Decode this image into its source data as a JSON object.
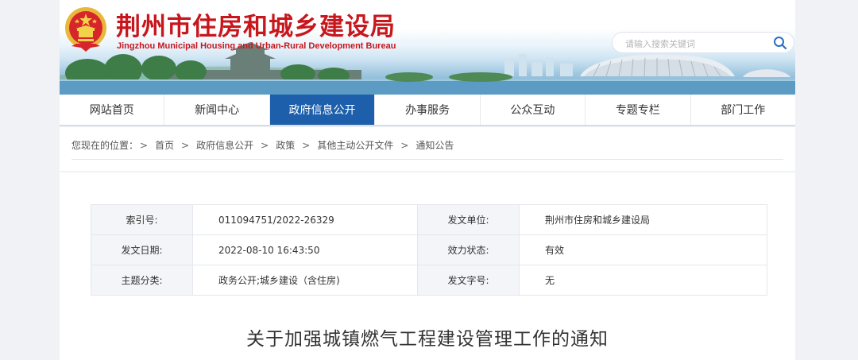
{
  "header": {
    "title": "荆州市住房和城乡建设局",
    "subtitle": "Jingzhou Municipal Housing and Urban-Rural Development Bureau",
    "search_placeholder": "请输入搜索关键词"
  },
  "nav": {
    "items": [
      "网站首页",
      "新闻中心",
      "政府信息公开",
      "办事服务",
      "公众互动",
      "专题专栏",
      "部门工作"
    ],
    "active_index": 2
  },
  "breadcrumb": {
    "prefix": "您现在的位置：",
    "items": [
      "首页",
      "政府信息公开",
      "政策",
      "其他主动公开文件",
      "通知公告"
    ],
    "separator": ">"
  },
  "meta": {
    "index_no_label": "索引号:",
    "index_no": "011094751/2022-26329",
    "issuer_label": "发文单位:",
    "issuer": "荆州市住房和城乡建设局",
    "date_label": "发文日期:",
    "date": "2022-08-10 16:43:50",
    "status_label": "效力状态:",
    "status": "有效",
    "category_label": "主题分类:",
    "category": "政务公开;城乡建设（含住房)",
    "doc_no_label": "发文字号:",
    "doc_no": "无"
  },
  "article": {
    "title": "关于加强城镇燃气工程建设管理工作的通知"
  },
  "colors": {
    "brand_red": "#c8161d",
    "nav_active": "#1d5fab",
    "page_bg": "#f0f2f5"
  },
  "icons": {
    "emblem": "national-emblem-icon",
    "search": "search-icon"
  }
}
